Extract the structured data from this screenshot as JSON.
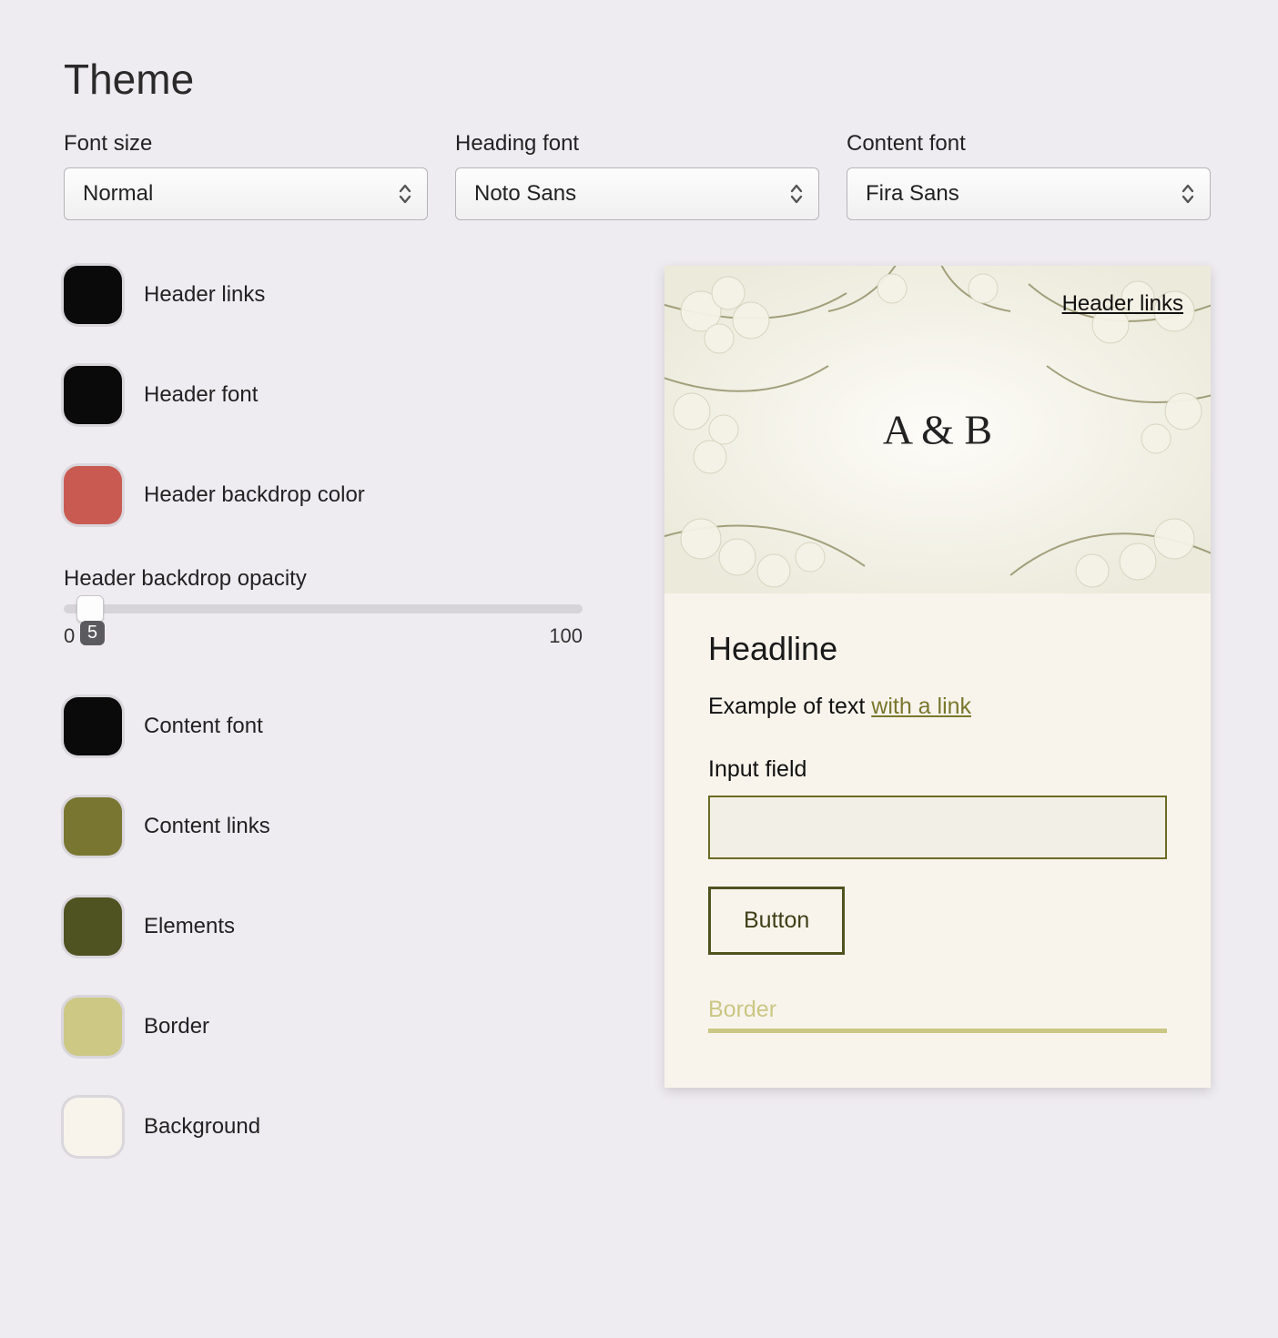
{
  "page_title": "Theme",
  "selects": {
    "font_size": {
      "label": "Font size",
      "value": "Normal"
    },
    "heading_font": {
      "label": "Heading font",
      "value": "Noto Sans"
    },
    "content_font": {
      "label": "Content font",
      "value": "Fira Sans"
    }
  },
  "swatches_top": [
    {
      "label": "Header links",
      "color": "#0a0a0a"
    },
    {
      "label": "Header font",
      "color": "#0a0a0a"
    },
    {
      "label": "Header backdrop color",
      "color": "#c85a51"
    }
  ],
  "slider": {
    "label": "Header backdrop opacity",
    "min": "0",
    "max": "100",
    "value": "5"
  },
  "swatches_bottom": [
    {
      "label": "Content font",
      "color": "#0a0a0a"
    },
    {
      "label": "Content links",
      "color": "#787631"
    },
    {
      "label": "Elements",
      "color": "#4f5221"
    },
    {
      "label": "Border",
      "color": "#cdc884"
    },
    {
      "label": "Background",
      "color": "#f8f4ec"
    }
  ],
  "preview": {
    "header_link": "Header links",
    "monogram": "A & B",
    "headline": "Headline",
    "example_text": "Example of text",
    "example_link": "with a link",
    "input_label": "Input field",
    "button_label": "Button",
    "border_label": "Border"
  }
}
